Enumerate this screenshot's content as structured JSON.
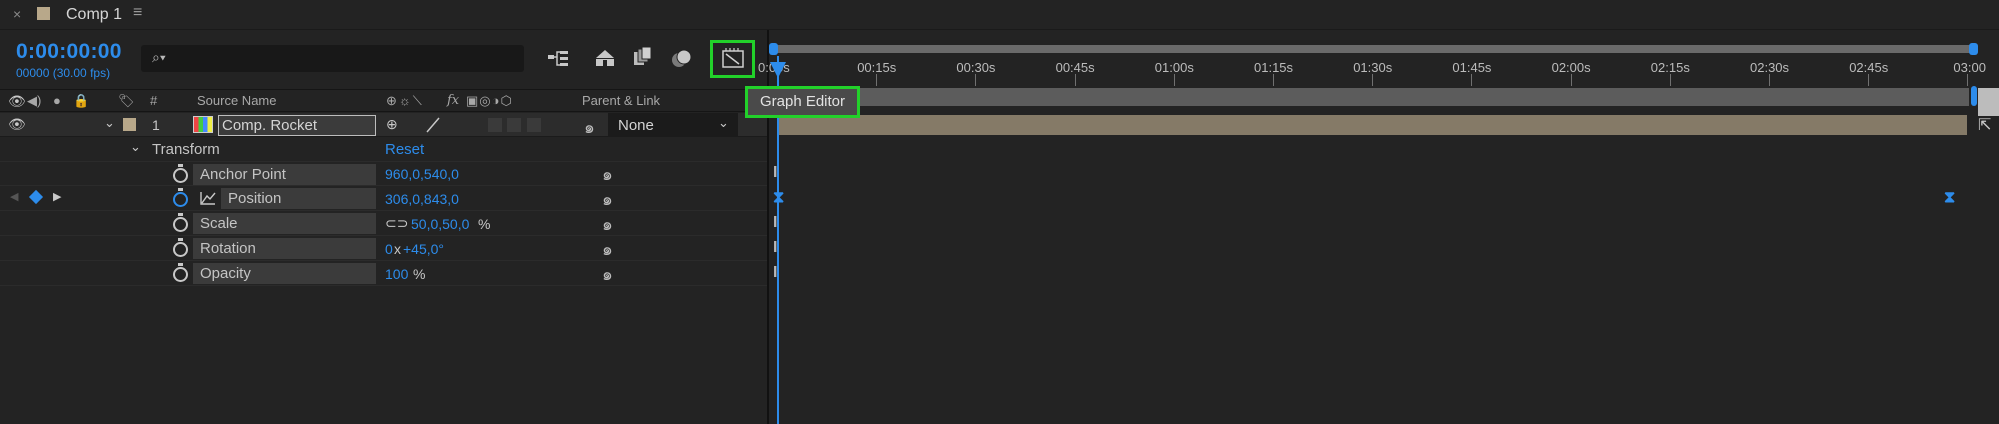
{
  "tab": {
    "close": "×",
    "title": "Comp 1",
    "menu": "≡",
    "swatch_color": "#b8a88a"
  },
  "time": {
    "timecode": "0:00:00:00",
    "fps": "00000 (30.00 fps)"
  },
  "search": {
    "icon": "⌕▾",
    "placeholder": ""
  },
  "toolbar": {
    "graph_editor_tooltip": "Graph Editor"
  },
  "columns": {
    "source_name": "Source Name",
    "parent_link": "Parent & Link",
    "hash": "#",
    "fx": "fx"
  },
  "layer": {
    "number": "1",
    "name": "Comp. Rocket",
    "parent": "None"
  },
  "transform": {
    "label": "Transform",
    "reset": "Reset",
    "properties": [
      {
        "name": "Anchor Point",
        "value": "960,0,540,0"
      },
      {
        "name": "Position",
        "value": "306,0,843,0"
      },
      {
        "name": "Scale",
        "value": "50,0,50,0",
        "suffix": "%"
      },
      {
        "name": "Rotation",
        "value_a": "0",
        "sep": "x",
        "value_b": "+45,0°"
      },
      {
        "name": "Opacity",
        "value": "100",
        "suffix": "%"
      }
    ]
  },
  "timeline": {
    "ticks": [
      "0:00s",
      "00:15s",
      "00:30s",
      "00:45s",
      "01:00s",
      "01:15s",
      "01:30s",
      "01:45s",
      "02:00s",
      "02:15s",
      "02:30s",
      "02:45s",
      "03:00"
    ]
  },
  "colors": {
    "accent": "#2d8ceb",
    "highlight": "#22d12a",
    "layer_bar": "#857a67"
  }
}
